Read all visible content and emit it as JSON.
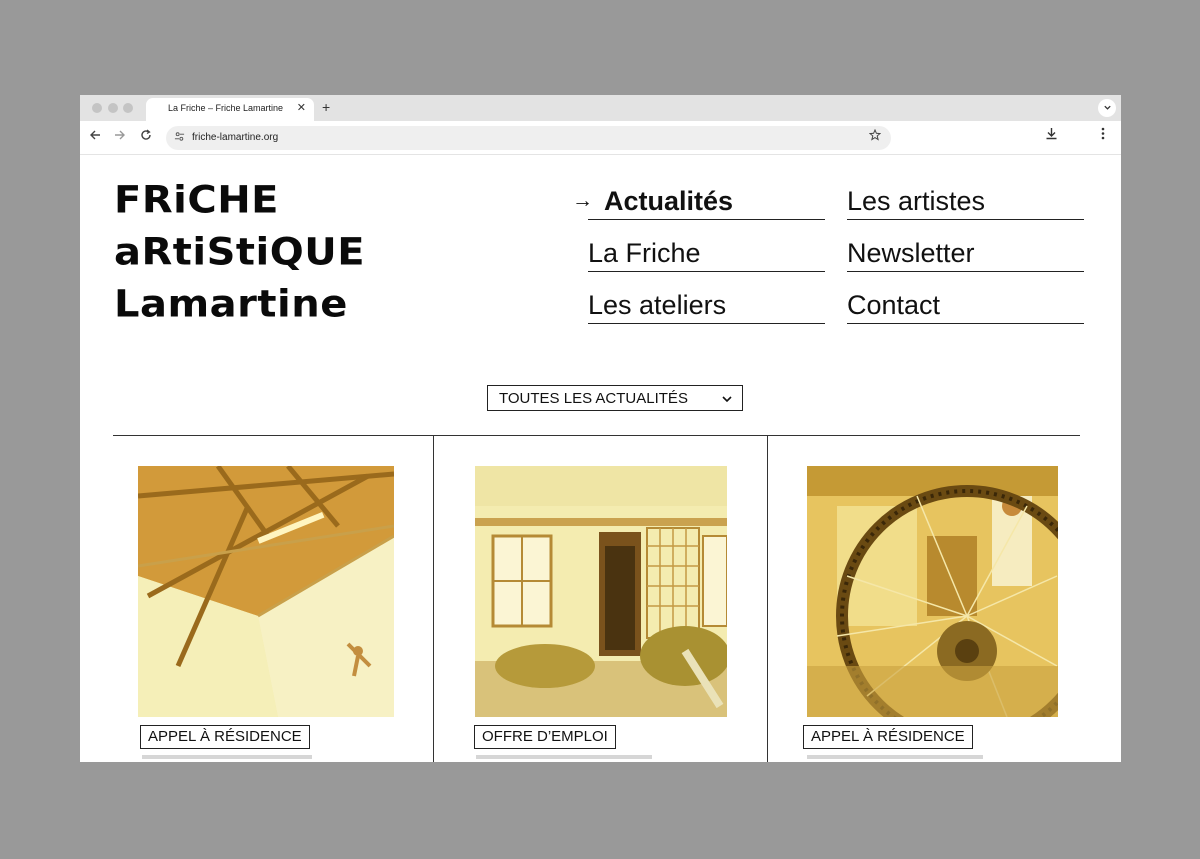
{
  "browser": {
    "tab_title": "La Friche – Friche Lamartine",
    "tab_close": "✕",
    "new_tab": "+",
    "tab_menu": "⌄",
    "url": "friche-lamartine.org",
    "icons": {
      "back": "back-arrow-icon",
      "forward": "forward-arrow-icon",
      "reload": "reload-icon",
      "site_settings": "site-settings-icon",
      "bookmark": "star-icon",
      "download": "download-icon",
      "menu": "kebab-menu-icon"
    }
  },
  "site": {
    "logo_lines": [
      "FRiCHE",
      "aRtiStiQUE",
      "Lamartine"
    ],
    "nav": [
      {
        "label": "Actualités",
        "active": true
      },
      {
        "label": "Les artistes",
        "active": false
      },
      {
        "label": "La Friche",
        "active": false
      },
      {
        "label": "Newsletter",
        "active": false
      },
      {
        "label": "Les ateliers",
        "active": false
      },
      {
        "label": "Contact",
        "active": false
      }
    ],
    "filter": {
      "label": "TOUTES LES ACTUALITÉS"
    },
    "cards": [
      {
        "tag": "APPEL À RÉSIDENCE"
      },
      {
        "tag": "OFFRE D’EMPLOI"
      },
      {
        "tag": "APPEL À RÉSIDENCE"
      }
    ]
  },
  "colors": {
    "backdrop": "#999999",
    "photo_tint": "#e8c463",
    "text": "#111111"
  }
}
